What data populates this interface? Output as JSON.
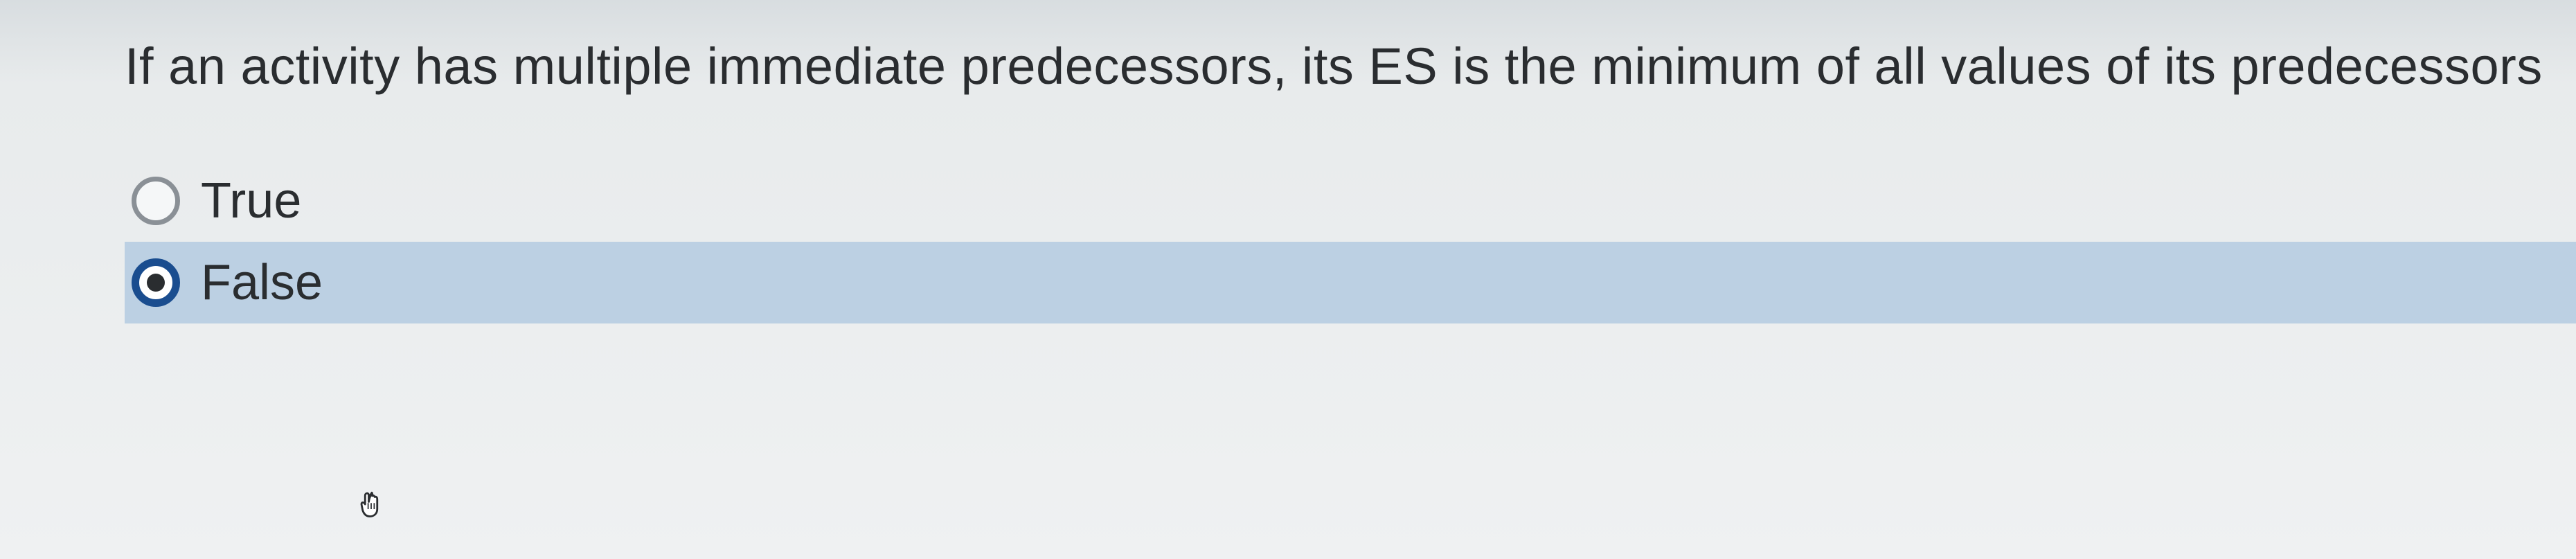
{
  "question": {
    "text": "If an activity has multiple immediate predecessors, its ES is the minimum of all values of its predecessors"
  },
  "options": [
    {
      "label": "True",
      "selected": false
    },
    {
      "label": "False",
      "selected": true
    }
  ]
}
